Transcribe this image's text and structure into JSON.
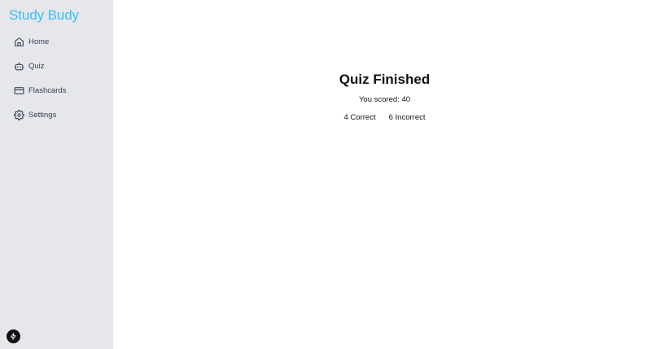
{
  "app": {
    "title": "Study Budy"
  },
  "sidebar": {
    "items": [
      {
        "label": "Home",
        "icon": "home-icon"
      },
      {
        "label": "Quiz",
        "icon": "robot-icon"
      },
      {
        "label": "Flashcards",
        "icon": "card-icon"
      },
      {
        "label": "Settings",
        "icon": "gear-icon"
      }
    ],
    "bottom_button_icon": "bolt-icon"
  },
  "main": {
    "title": "Quiz Finished",
    "score_label": "You scored:",
    "score_value": "40",
    "correct_count": "4",
    "correct_label": "Correct",
    "incorrect_count": "6",
    "incorrect_label": "Incorrect"
  },
  "colors": {
    "brand": "#38bdf8",
    "sidebar_bg": "#e5e7eb",
    "main_bg": "#ffffff"
  }
}
